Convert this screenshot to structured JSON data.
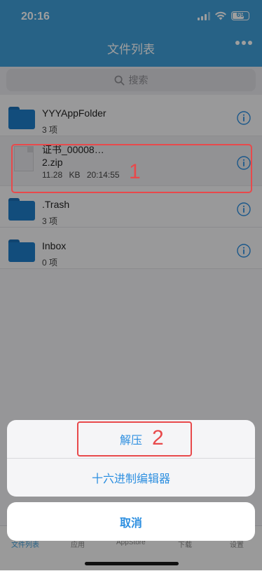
{
  "status": {
    "time": "20:16",
    "battery": "69"
  },
  "header": {
    "title": "文件列表",
    "more_icon": "more-dots-icon"
  },
  "search": {
    "placeholder": "搜索",
    "icon": "search-icon"
  },
  "list": [
    {
      "type": "folder",
      "name": "YYYAppFolder",
      "sub": "3 项"
    },
    {
      "type": "file",
      "name_line1": "证书_00008…",
      "name_line2": "2.zip",
      "size": "11.28 KB",
      "time": "20:14:55"
    },
    {
      "type": "folder",
      "name": ".Trash",
      "sub": "3 项"
    },
    {
      "type": "folder",
      "name": "Inbox",
      "sub": "0 项"
    }
  ],
  "annotations": {
    "label1": "1",
    "label2": "2"
  },
  "tabbar": {
    "items": [
      "文件列表",
      "应用",
      "AppStore",
      "下载",
      "设置"
    ]
  },
  "sheet": {
    "option1": "解压",
    "option2": "十六进制编辑器",
    "cancel": "取消"
  },
  "colors": {
    "accent": "#3f9ed8",
    "action_blue": "#2d8fe0",
    "annotation_red": "#e8494b"
  }
}
